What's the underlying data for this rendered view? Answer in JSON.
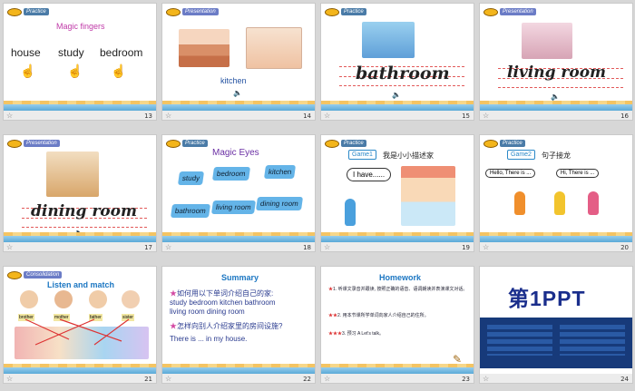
{
  "slides": [
    {
      "num": "13",
      "header": "Practice",
      "title": "Magic fingers",
      "words": [
        "house",
        "study",
        "bedroom"
      ]
    },
    {
      "num": "14",
      "header": "Presentation",
      "label": "kitchen"
    },
    {
      "num": "15",
      "header": "Practice",
      "word": "bathroom"
    },
    {
      "num": "16",
      "header": "Presentation",
      "word": "living room"
    },
    {
      "num": "17",
      "header": "Presentation",
      "word": "dining room"
    },
    {
      "num": "18",
      "header": "Practice",
      "title": "Magic Eyes",
      "cards": [
        "study",
        "bedroom",
        "kitchen",
        "bathroom",
        "living room",
        "dining room"
      ]
    },
    {
      "num": "19",
      "header": "Practice",
      "game": "Game1",
      "title": "我是小小描述家",
      "bubble": "I have......"
    },
    {
      "num": "20",
      "header": "Practice",
      "game": "Game2",
      "title": "句子接龙",
      "bubbles": [
        "Hello, There is ...",
        "Hi, There is ..."
      ]
    },
    {
      "num": "21",
      "header": "Consolidation",
      "title": "Listen and match",
      "names": [
        "brother",
        "mother",
        "father",
        "sister"
      ]
    },
    {
      "num": "22",
      "title": "Summary",
      "line1": "如何用以下单词介绍自己的家:",
      "line2": "study  bedroom  kitchen  bathroom",
      "line3": "living room     dining room",
      "line4": "怎样向别人介绍家里的房间设施?",
      "line5": "There is ... in my house."
    },
    {
      "num": "23",
      "title": "Homework",
      "items": [
        "1. 听课文录音并跟读, 按照正确的语音、语调朗读并表演课文对话。",
        "2. 用本节课所学单词向家人介绍自己的住所。",
        "3. 预习 A Let's talk。"
      ],
      "close": "close"
    },
    {
      "num": "24",
      "logo": "第1PPT"
    }
  ]
}
